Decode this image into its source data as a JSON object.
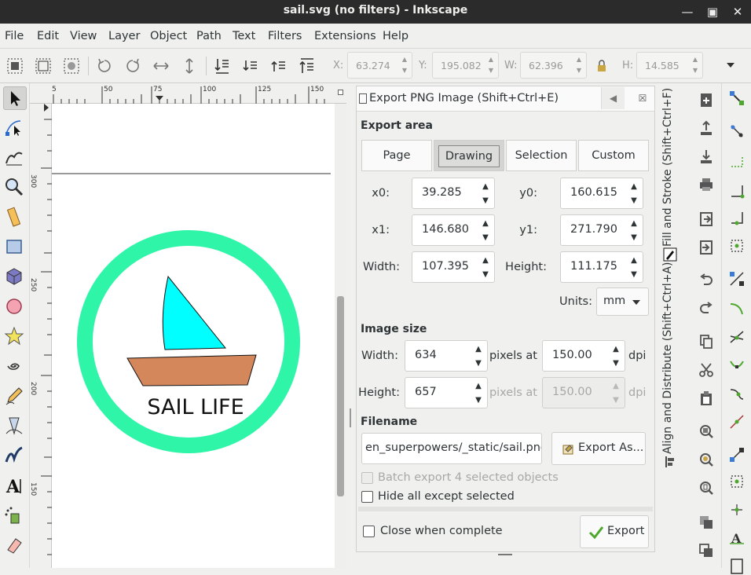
{
  "window": {
    "title": "sail.svg (no filters) - Inkscape"
  },
  "menu": [
    "File",
    "Edit",
    "View",
    "Layer",
    "Object",
    "Path",
    "Text",
    "Filters",
    "Extensions",
    "Help"
  ],
  "coords": {
    "x_label": "X:",
    "x_value": "63.274",
    "y_label": "Y:",
    "y_value": "195.082",
    "w_label": "W:",
    "w_value": "62.396",
    "h_label": "H:",
    "h_value": "14.585"
  },
  "ruler": {
    "h_ticks": [
      "5",
      "50",
      "75",
      "100",
      "125",
      "150"
    ],
    "v_ticks": [
      "300",
      "250",
      "200",
      "150"
    ]
  },
  "artwork": {
    "text": "SAIL LIFE",
    "ring_color": "#2ef5a8",
    "sail_color": "#00ffff",
    "hull_color": "#d4875a"
  },
  "export": {
    "title": "Export PNG Image (Shift+Ctrl+E)",
    "area_label": "Export area",
    "area_buttons": [
      "Page",
      "Drawing",
      "Selection",
      "Custom"
    ],
    "active_area": "Drawing",
    "x0_label": "x0:",
    "x0": "39.285",
    "y0_label": "y0:",
    "y0": "160.615",
    "x1_label": "x1:",
    "x1": "146.680",
    "y1_label": "y1:",
    "y1": "271.790",
    "width_label": "Width:",
    "width": "107.395",
    "height_label": "Height:",
    "height": "111.175",
    "units_label": "Units:",
    "units": "mm",
    "image_size_label": "Image size",
    "img_width_label": "Width:",
    "img_width": "634",
    "img_height_label": "Height:",
    "img_height": "657",
    "pixels_at": "pixels at",
    "dpi_x": "150.00",
    "dpi_y": "150.00",
    "dpi_label": "dpi",
    "filename_label": "Filename",
    "filename": "en_superpowers/_static/sail.png",
    "export_as": "Export As...",
    "batch_export": "Batch export 4 selected objects",
    "hide_all": "Hide all except selected",
    "close_when_complete": "Close when complete",
    "export_button": "Export"
  },
  "side_tabs": {
    "fill_stroke": "Fill and Stroke (Shift+Ctrl+F)",
    "align": "Align and Distribute (Shift+Ctrl+A)"
  }
}
